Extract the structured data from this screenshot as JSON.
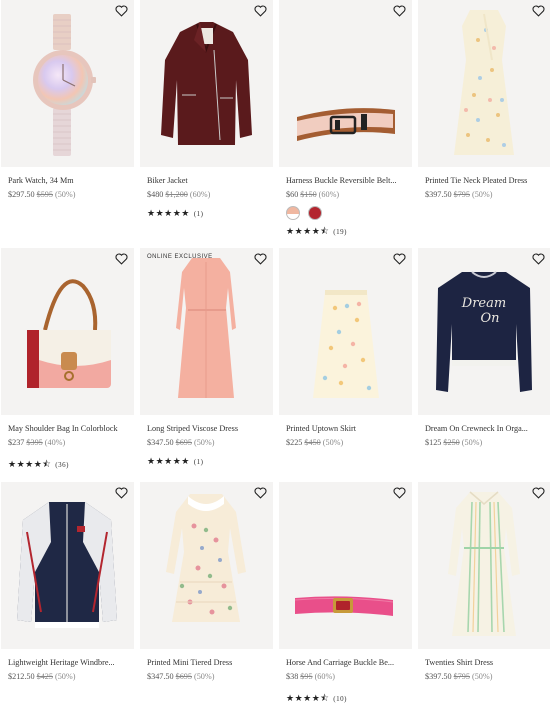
{
  "products": [
    {
      "name": "Park Watch, 34 Mm",
      "price": "$297.50",
      "original": "$595",
      "discount": "(50%)"
    },
    {
      "name": "Biker Jacket",
      "price": "$480",
      "original": "$1,200",
      "discount": "(60%)",
      "rating": 5,
      "review_count": "(1)"
    },
    {
      "name": "Harness Buckle Reversible Belt...",
      "price": "$60",
      "original": "$150",
      "discount": "(60%)",
      "rating": 4.5,
      "review_count": "(19)",
      "swatches": [
        "#f0b7a0",
        "#b3262f"
      ]
    },
    {
      "name": "Printed Tie Neck Pleated Dress",
      "price": "$397.50",
      "original": "$795",
      "discount": "(50%)"
    },
    {
      "name": "May Shoulder Bag In Colorblock",
      "price": "$237",
      "original": "$395",
      "discount": "(40%)",
      "rating": 4.5,
      "review_count": "(36)"
    },
    {
      "badge": "ONLINE EXCLUSIVE",
      "name": "Long Striped Viscose Dress",
      "price": "$347.50",
      "original": "$695",
      "discount": "(50%)",
      "rating": 5,
      "review_count": "(1)"
    },
    {
      "name": "Printed Uptown Skirt",
      "price": "$225",
      "original": "$450",
      "discount": "(50%)"
    },
    {
      "name": "Dream On Crewneck In Orga...",
      "price": "$125",
      "original": "$250",
      "discount": "(50%)"
    },
    {
      "name": "Lightweight Heritage Windbre...",
      "price": "$212.50",
      "original": "$425",
      "discount": "(50%)"
    },
    {
      "name": "Printed Mini Tiered Dress",
      "price": "$347.50",
      "original": "$695",
      "discount": "(50%)"
    },
    {
      "name": "Horse And Carriage Buckle Be...",
      "price": "$38",
      "original": "$95",
      "discount": "(60%)",
      "rating": 4.5,
      "review_count": "(10)"
    },
    {
      "name": "Twenties Shirt Dress",
      "price": "$397.50",
      "original": "$795",
      "discount": "(50%)"
    }
  ],
  "sweater_print": {
    "line1": "Dream",
    "line2": "On"
  }
}
